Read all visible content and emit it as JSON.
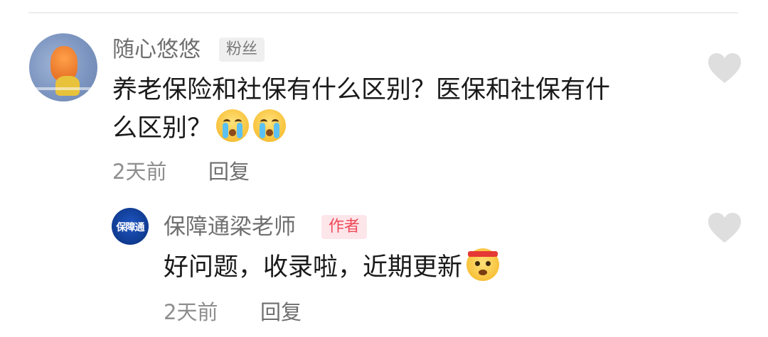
{
  "comments": [
    {
      "username": "随心悠悠",
      "badge": "粉丝",
      "text_line1": "养老保险和社保有什么区别？医保和社保有什",
      "text_line2": "么区别？",
      "emojis": [
        "crying-face-emoji",
        "crying-face-emoji"
      ],
      "time": "2天前",
      "reply_label": "回复"
    }
  ],
  "reply": {
    "username": "保障通梁老师",
    "badge": "作者",
    "avatar_text": "保障通",
    "text": "好问题，收录啦，近期更新",
    "emoji": "angry-headband-face-emoji",
    "time": "2天前",
    "reply_label": "回复"
  },
  "colors": {
    "author_badge_bg": "#fde6ea",
    "author_badge_text": "#f04a5a",
    "heart": "#dedede"
  }
}
